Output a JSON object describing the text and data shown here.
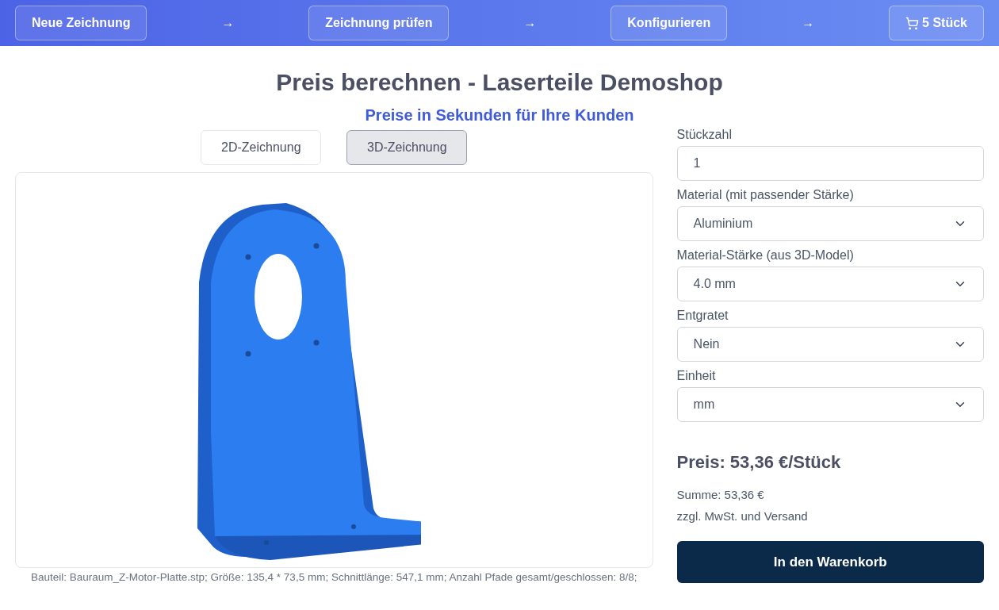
{
  "nav": {
    "steps": [
      {
        "kind": "step",
        "label": "Neue Zeichnung"
      },
      {
        "kind": "arrow",
        "label": "→"
      },
      {
        "kind": "step",
        "label": "Zeichnung prüfen"
      },
      {
        "kind": "arrow",
        "label": "→"
      },
      {
        "kind": "step",
        "label": "Konfigurieren"
      },
      {
        "kind": "arrow",
        "label": "→"
      },
      {
        "kind": "cart",
        "label": "5 Stück"
      }
    ]
  },
  "title": "Preis berechnen - Laserteile Demoshop",
  "subtitle": "Preise in Sekunden für Ihre Kunden",
  "view_tabs": [
    {
      "label": "2D-Zeichnung",
      "selected": false
    },
    {
      "label": "3D-Zeichnung",
      "selected": true
    }
  ],
  "caption": "Bauteil: Bauraum_Z-Motor-Platte.stp; Größe: 135,4 * 73,5 mm; Schnittlänge: 547,1 mm; Anzahl Pfade gesamt/geschlossen: 8/8;",
  "fields": [
    {
      "kind": "input",
      "label": "Stückzahl",
      "value": "1"
    },
    {
      "kind": "select",
      "label": "Material (mit passender Stärke)",
      "value": "Aluminium"
    },
    {
      "kind": "select",
      "label": "Material-Stärke (aus 3D-Model)",
      "value": "4.0 mm"
    },
    {
      "kind": "select",
      "label": "Entgratet",
      "value": "Nein"
    },
    {
      "kind": "select",
      "label": "Einheit",
      "value": "mm"
    }
  ],
  "price": "Preis: 53,36 €/Stück",
  "sum": "Summe: 53,36 €",
  "note": "zzgl. MwSt. und Versand",
  "cart_button": "In den Warenkorb"
}
